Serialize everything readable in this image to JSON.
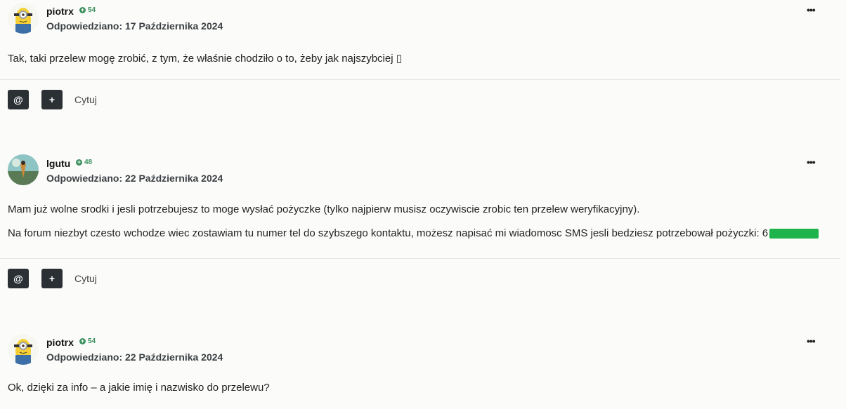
{
  "posts": [
    {
      "author": "piotrx",
      "reputation": "54",
      "answered_label": "Odpowiedziano:",
      "date": "17 Października 2024",
      "paragraphs": [
        "Tak, taki przelew mogę zrobić, z tym, że właśnie chodziło o to, żeby jak najszybciej ▯"
      ],
      "avatar": "minion",
      "actions": {
        "mention": "@",
        "plus": "+",
        "quote": "Cytuj"
      },
      "more": "•••"
    },
    {
      "author": "lgutu",
      "reputation": "48",
      "answered_label": "Odpowiedziano:",
      "date": "22 Października 2024",
      "paragraphs": [
        "Mam już wolne srodki i jesli potrzebujesz to moge wysłać pożyczke (tylko najpierw musisz oczywiscie zrobic ten przelew weryfikacyjny).",
        "Na forum niezbyt czesto wchodze wiec zostawiam tu numer tel do szybszego kontaktu, możesz napisać mi wiadomosc SMS jesli bedziesz potrzebował pożyczki: 6"
      ],
      "avatar": "landscape",
      "actions": {
        "mention": "@",
        "plus": "+",
        "quote": "Cytuj"
      },
      "more": "•••"
    },
    {
      "author": "piotrx",
      "reputation": "54",
      "answered_label": "Odpowiedziano:",
      "date": "22 Października 2024",
      "paragraphs": [
        "Ok, dzięki za info – a jakie imię i nazwisko do przelewu?"
      ],
      "avatar": "minion",
      "more": "•••"
    }
  ],
  "colors": {
    "reputation": "#3a8f5e",
    "button_bg": "#2b3035",
    "redaction": "#1fb34c"
  },
  "icons": {
    "reputation": "plus-circle-icon",
    "more": "ellipsis-icon"
  }
}
